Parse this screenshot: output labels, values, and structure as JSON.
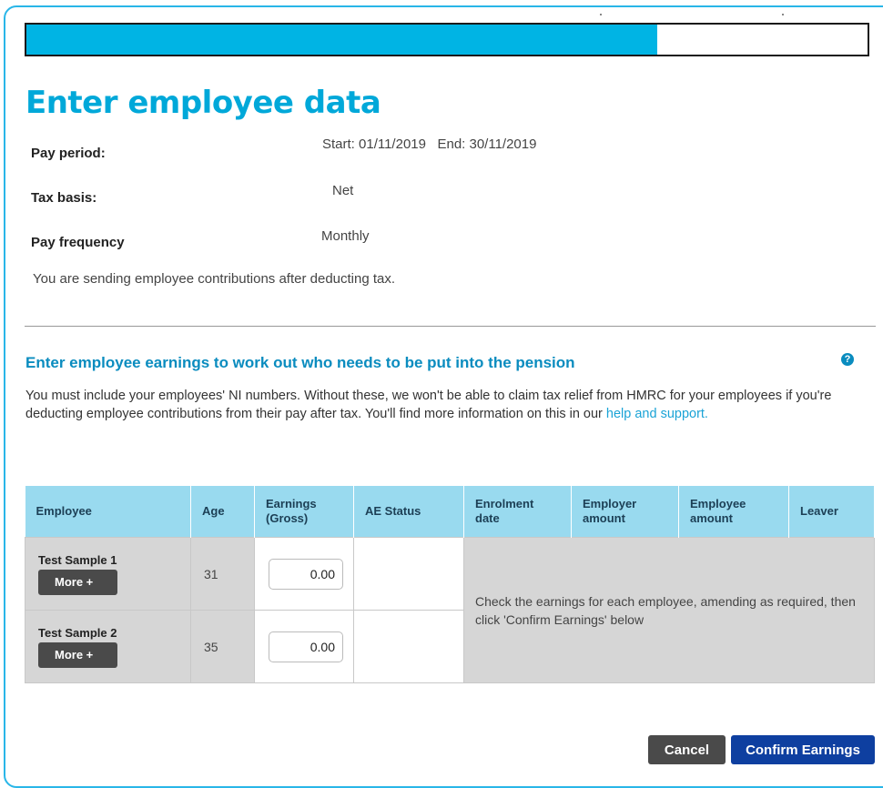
{
  "progress": {
    "fraction": 0.75,
    "color": "#00b4e4"
  },
  "page_title": "Enter employee data",
  "pay_period": {
    "label": "Pay period:",
    "value": "Start: 01/11/2019   End: 30/11/2019"
  },
  "tax_basis": {
    "label": "Tax basis:",
    "value": "Net"
  },
  "pay_frequency": {
    "label": "Pay frequency",
    "value": "Monthly"
  },
  "contribution_note": "You are sending employee contributions after deducting tax.",
  "section": {
    "title": "Enter employee earnings to work out who needs to be put into the pension",
    "help_icon": "question-circle-icon",
    "paragraph": "You must include your employees' NI numbers. Without these, we won't be able to claim tax relief from HMRC for your employees if you're deducting employee contributions from their pay after tax. You'll find more information on this in our ",
    "link_text": "help and support."
  },
  "table": {
    "headers": {
      "employee": "Employee",
      "age": "Age",
      "earnings": "Earnings (Gross)",
      "ae_status": "AE Status",
      "enrolment_date": "Enrolment date",
      "employer_amount": "Employer amount",
      "employee_amount": "Employee amount",
      "leaver": "Leaver"
    },
    "rows": [
      {
        "name": "Test Sample 1",
        "more_label": "More +",
        "age": "31",
        "earnings": "0.00"
      },
      {
        "name": "Test Sample 2",
        "more_label": "More +",
        "age": "35",
        "earnings": "0.00"
      }
    ],
    "message": "Check the earnings for each employee, amending as required, then click 'Confirm Earnings' below"
  },
  "buttons": {
    "cancel": "Cancel",
    "confirm": "Confirm Earnings"
  },
  "colors": {
    "accent": "#00a8d9",
    "header_bg": "#99daef",
    "confirm_bg": "#0e3fa0",
    "dark_button": "#4a4a4a"
  }
}
